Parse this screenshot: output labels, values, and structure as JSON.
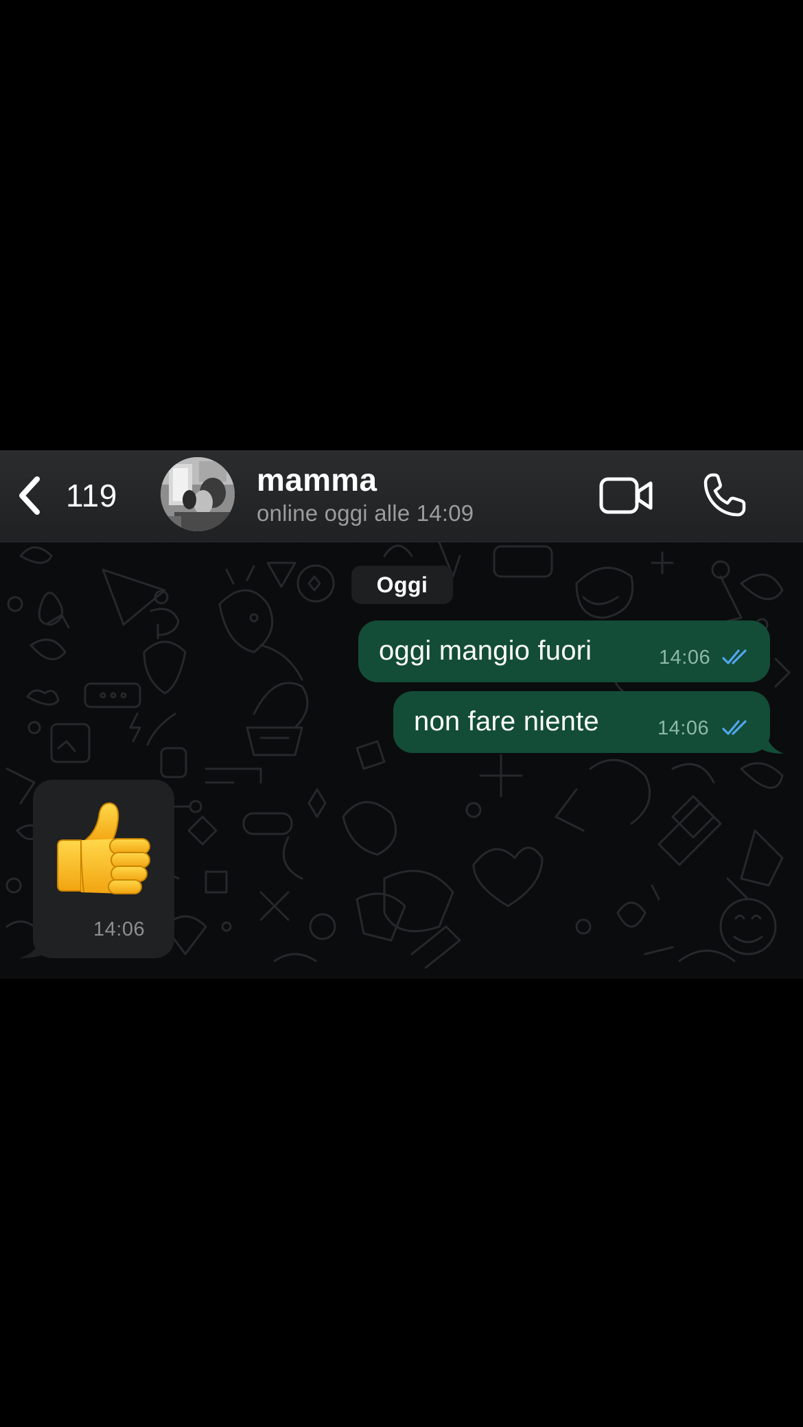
{
  "header": {
    "unread_count": "119",
    "contact_name": "mamma",
    "contact_status": "online oggi alle 14:09",
    "icons": {
      "back": "chevron-left-icon",
      "video_call": "video-camera-icon",
      "voice_call": "phone-icon"
    }
  },
  "chat": {
    "date_separator": "Oggi",
    "messages": [
      {
        "direction": "outgoing",
        "text": "oggi mangio fuori",
        "time": "14:06",
        "status": "read"
      },
      {
        "direction": "outgoing",
        "text": "non fare niente",
        "time": "14:06",
        "status": "read"
      },
      {
        "direction": "incoming",
        "emoji": "thumbs-up",
        "time": "14:06"
      }
    ]
  },
  "colors": {
    "outgoing_bubble": "#134d37",
    "incoming_bubble": "#1f2123",
    "read_ticks": "#53a6f0",
    "header_bg": "#26282a",
    "chat_bg": "#0b0c0d",
    "status_text": "#9a9c9e"
  }
}
